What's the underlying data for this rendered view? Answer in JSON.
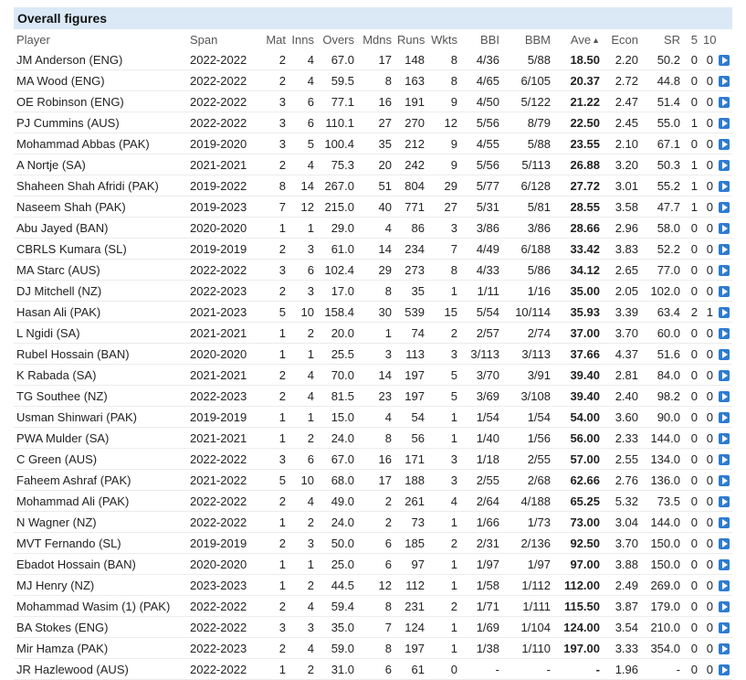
{
  "title": "Overall figures",
  "headers": {
    "player": "Player",
    "span": "Span",
    "mat": "Mat",
    "inns": "Inns",
    "overs": "Overs",
    "mdns": "Mdns",
    "runs": "Runs",
    "wkts": "Wkts",
    "bbi": "BBI",
    "bbm": "BBM",
    "ave": "Ave",
    "econ": "Econ",
    "sr": "SR",
    "five": "5",
    "ten": "10"
  },
  "sort_arrow": "▲",
  "rows": [
    [
      "JM Anderson (ENG)",
      "2022-2022",
      "2",
      "4",
      "67.0",
      "17",
      "148",
      "8",
      "4/36",
      "5/88",
      "18.50",
      "2.20",
      "50.2",
      "0",
      "0"
    ],
    [
      "MA Wood (ENG)",
      "2022-2022",
      "2",
      "4",
      "59.5",
      "8",
      "163",
      "8",
      "4/65",
      "6/105",
      "20.37",
      "2.72",
      "44.8",
      "0",
      "0"
    ],
    [
      "OE Robinson (ENG)",
      "2022-2022",
      "3",
      "6",
      "77.1",
      "16",
      "191",
      "9",
      "4/50",
      "5/122",
      "21.22",
      "2.47",
      "51.4",
      "0",
      "0"
    ],
    [
      "PJ Cummins (AUS)",
      "2022-2022",
      "3",
      "6",
      "110.1",
      "27",
      "270",
      "12",
      "5/56",
      "8/79",
      "22.50",
      "2.45",
      "55.0",
      "1",
      "0"
    ],
    [
      "Mohammad Abbas (PAK)",
      "2019-2020",
      "3",
      "5",
      "100.4",
      "35",
      "212",
      "9",
      "4/55",
      "5/88",
      "23.55",
      "2.10",
      "67.1",
      "0",
      "0"
    ],
    [
      "A Nortje (SA)",
      "2021-2021",
      "2",
      "4",
      "75.3",
      "20",
      "242",
      "9",
      "5/56",
      "5/113",
      "26.88",
      "3.20",
      "50.3",
      "1",
      "0"
    ],
    [
      "Shaheen Shah Afridi (PAK)",
      "2019-2022",
      "8",
      "14",
      "267.0",
      "51",
      "804",
      "29",
      "5/77",
      "6/128",
      "27.72",
      "3.01",
      "55.2",
      "1",
      "0"
    ],
    [
      "Naseem Shah (PAK)",
      "2019-2023",
      "7",
      "12",
      "215.0",
      "40",
      "771",
      "27",
      "5/31",
      "5/81",
      "28.55",
      "3.58",
      "47.7",
      "1",
      "0"
    ],
    [
      "Abu Jayed (BAN)",
      "2020-2020",
      "1",
      "1",
      "29.0",
      "4",
      "86",
      "3",
      "3/86",
      "3/86",
      "28.66",
      "2.96",
      "58.0",
      "0",
      "0"
    ],
    [
      "CBRLS Kumara (SL)",
      "2019-2019",
      "2",
      "3",
      "61.0",
      "14",
      "234",
      "7",
      "4/49",
      "6/188",
      "33.42",
      "3.83",
      "52.2",
      "0",
      "0"
    ],
    [
      "MA Starc (AUS)",
      "2022-2022",
      "3",
      "6",
      "102.4",
      "29",
      "273",
      "8",
      "4/33",
      "5/86",
      "34.12",
      "2.65",
      "77.0",
      "0",
      "0"
    ],
    [
      "DJ Mitchell (NZ)",
      "2022-2023",
      "2",
      "3",
      "17.0",
      "8",
      "35",
      "1",
      "1/11",
      "1/16",
      "35.00",
      "2.05",
      "102.0",
      "0",
      "0"
    ],
    [
      "Hasan Ali (PAK)",
      "2021-2023",
      "5",
      "10",
      "158.4",
      "30",
      "539",
      "15",
      "5/54",
      "10/114",
      "35.93",
      "3.39",
      "63.4",
      "2",
      "1"
    ],
    [
      "L Ngidi (SA)",
      "2021-2021",
      "1",
      "2",
      "20.0",
      "1",
      "74",
      "2",
      "2/57",
      "2/74",
      "37.00",
      "3.70",
      "60.0",
      "0",
      "0"
    ],
    [
      "Rubel Hossain (BAN)",
      "2020-2020",
      "1",
      "1",
      "25.5",
      "3",
      "113",
      "3",
      "3/113",
      "3/113",
      "37.66",
      "4.37",
      "51.6",
      "0",
      "0"
    ],
    [
      "K Rabada (SA)",
      "2021-2021",
      "2",
      "4",
      "70.0",
      "14",
      "197",
      "5",
      "3/70",
      "3/91",
      "39.40",
      "2.81",
      "84.0",
      "0",
      "0"
    ],
    [
      "TG Southee (NZ)",
      "2022-2023",
      "2",
      "4",
      "81.5",
      "23",
      "197",
      "5",
      "3/69",
      "3/108",
      "39.40",
      "2.40",
      "98.2",
      "0",
      "0"
    ],
    [
      "Usman Shinwari (PAK)",
      "2019-2019",
      "1",
      "1",
      "15.0",
      "4",
      "54",
      "1",
      "1/54",
      "1/54",
      "54.00",
      "3.60",
      "90.0",
      "0",
      "0"
    ],
    [
      "PWA Mulder (SA)",
      "2021-2021",
      "1",
      "2",
      "24.0",
      "8",
      "56",
      "1",
      "1/40",
      "1/56",
      "56.00",
      "2.33",
      "144.0",
      "0",
      "0"
    ],
    [
      "C Green (AUS)",
      "2022-2022",
      "3",
      "6",
      "67.0",
      "16",
      "171",
      "3",
      "1/18",
      "2/55",
      "57.00",
      "2.55",
      "134.0",
      "0",
      "0"
    ],
    [
      "Faheem Ashraf (PAK)",
      "2021-2022",
      "5",
      "10",
      "68.0",
      "17",
      "188",
      "3",
      "2/55",
      "2/68",
      "62.66",
      "2.76",
      "136.0",
      "0",
      "0"
    ],
    [
      "Mohammad Ali (PAK)",
      "2022-2022",
      "2",
      "4",
      "49.0",
      "2",
      "261",
      "4",
      "2/64",
      "4/188",
      "65.25",
      "5.32",
      "73.5",
      "0",
      "0"
    ],
    [
      "N Wagner (NZ)",
      "2022-2022",
      "1",
      "2",
      "24.0",
      "2",
      "73",
      "1",
      "1/66",
      "1/73",
      "73.00",
      "3.04",
      "144.0",
      "0",
      "0"
    ],
    [
      "MVT Fernando (SL)",
      "2019-2019",
      "2",
      "3",
      "50.0",
      "6",
      "185",
      "2",
      "2/31",
      "2/136",
      "92.50",
      "3.70",
      "150.0",
      "0",
      "0"
    ],
    [
      "Ebadot Hossain (BAN)",
      "2020-2020",
      "1",
      "1",
      "25.0",
      "6",
      "97",
      "1",
      "1/97",
      "1/97",
      "97.00",
      "3.88",
      "150.0",
      "0",
      "0"
    ],
    [
      "MJ Henry (NZ)",
      "2023-2023",
      "1",
      "2",
      "44.5",
      "12",
      "112",
      "1",
      "1/58",
      "1/112",
      "112.00",
      "2.49",
      "269.0",
      "0",
      "0"
    ],
    [
      "Mohammad Wasim (1) (PAK)",
      "2022-2022",
      "2",
      "4",
      "59.4",
      "8",
      "231",
      "2",
      "1/71",
      "1/111",
      "115.50",
      "3.87",
      "179.0",
      "0",
      "0"
    ],
    [
      "BA Stokes (ENG)",
      "2022-2022",
      "3",
      "3",
      "35.0",
      "7",
      "124",
      "1",
      "1/69",
      "1/104",
      "124.00",
      "3.54",
      "210.0",
      "0",
      "0"
    ],
    [
      "Mir Hamza (PAK)",
      "2022-2023",
      "2",
      "4",
      "59.0",
      "8",
      "197",
      "1",
      "1/38",
      "1/110",
      "197.00",
      "3.33",
      "354.0",
      "0",
      "0"
    ],
    [
      "JR Hazlewood (AUS)",
      "2022-2022",
      "1",
      "2",
      "31.0",
      "6",
      "61",
      "0",
      "-",
      "-",
      "-",
      "1.96",
      "-",
      "0",
      "0"
    ]
  ]
}
